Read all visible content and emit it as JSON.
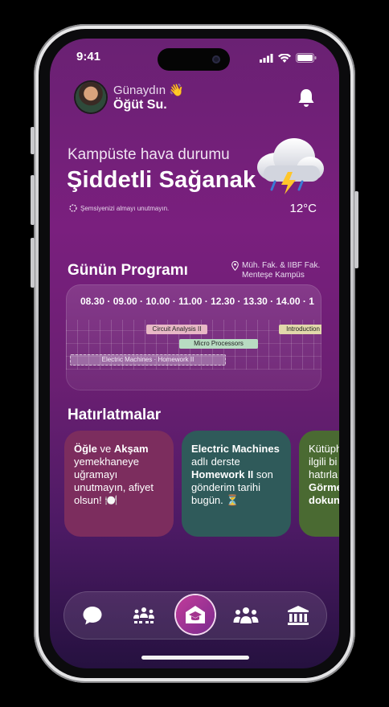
{
  "status": {
    "time": "9:41"
  },
  "header": {
    "greeting": "Günaydın 👋",
    "username": "Öğüt Su."
  },
  "weather": {
    "subtitle": "Kampüste hava durumu",
    "condition": "Şiddetli Sağanak",
    "note": "Şemsiyenizi almayı unutmayın.",
    "temperature": "12°C"
  },
  "program": {
    "title": "Günün Programı",
    "location_line1": "Müh. Fak. & IIBF Fak.",
    "location_line2": "Menteşe Kampüs",
    "hours": "08.30 · 09.00 · 10.00 · 11.00 · 12.30 · 13.30 · 14.00 · 1",
    "courses": [
      "Circuit Analysis II",
      "Micro Processors",
      "Introduction",
      "Electric Machines · Homework II"
    ]
  },
  "reminders": {
    "title": "Hatırlatmalar",
    "cards": [
      {
        "p1": "Öğle",
        "p2": " ve ",
        "p3": "Akşam",
        "p4": " yemekhaneye uğramayı unutmayın, afiyet olsun! 🍽️"
      },
      {
        "p1": "Electric Machines",
        "p2": " adlı derste ",
        "p3": "Homework II",
        "p4": " son gönderim tarihi bugün. ⏳"
      },
      {
        "p1": "Kütüph",
        "p2": "ilgili bi",
        "p3": "hatırla",
        "p4": "Görme",
        "p5": "dokun"
      }
    ]
  },
  "nav": {
    "items": [
      "chat-icon",
      "community-icon",
      "home-icon",
      "groups-icon",
      "university-icon"
    ]
  },
  "colors": {
    "accent": "#c23c9a",
    "background_top": "#6a2173",
    "background_bottom": "#25113f"
  }
}
